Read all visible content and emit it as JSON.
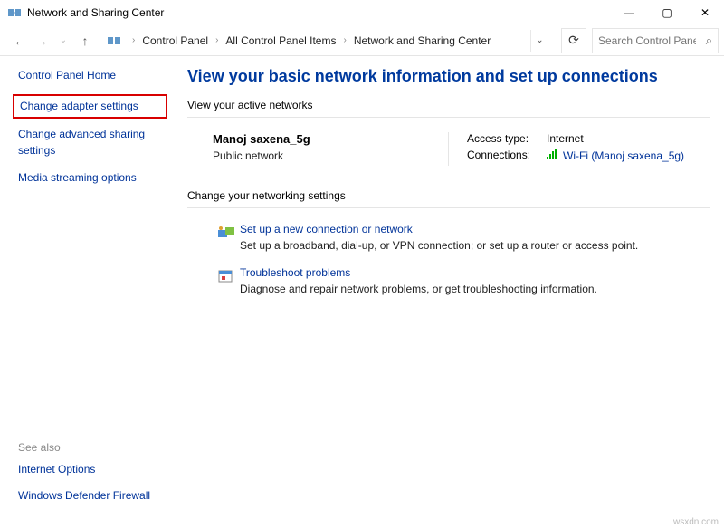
{
  "window": {
    "title": "Network and Sharing Center"
  },
  "breadcrumb": {
    "items": [
      "Control Panel",
      "All Control Panel Items",
      "Network and Sharing Center"
    ]
  },
  "search": {
    "placeholder": "Search Control Panel"
  },
  "sidebar": {
    "home": "Control Panel Home",
    "adapter": "Change adapter settings",
    "advanced": "Change advanced sharing settings",
    "streaming": "Media streaming options",
    "see_also": "See also",
    "internet_options": "Internet Options",
    "firewall": "Windows Defender Firewall"
  },
  "main": {
    "heading": "View your basic network information and set up connections",
    "active_section": "View your active networks",
    "network": {
      "name": "Manoj saxena_5g",
      "desc": "Public network",
      "access_label": "Access type:",
      "access_value": "Internet",
      "conn_label": "Connections:",
      "conn_value": "Wi-Fi (Manoj saxena_5g)"
    },
    "settings_section": "Change your networking settings",
    "setup": {
      "link": "Set up a new connection or network",
      "desc": "Set up a broadband, dial-up, or VPN connection; or set up a router or access point."
    },
    "troubleshoot": {
      "link": "Troubleshoot problems",
      "desc": "Diagnose and repair network problems, or get troubleshooting information."
    }
  },
  "watermark": "wsxdn.com"
}
